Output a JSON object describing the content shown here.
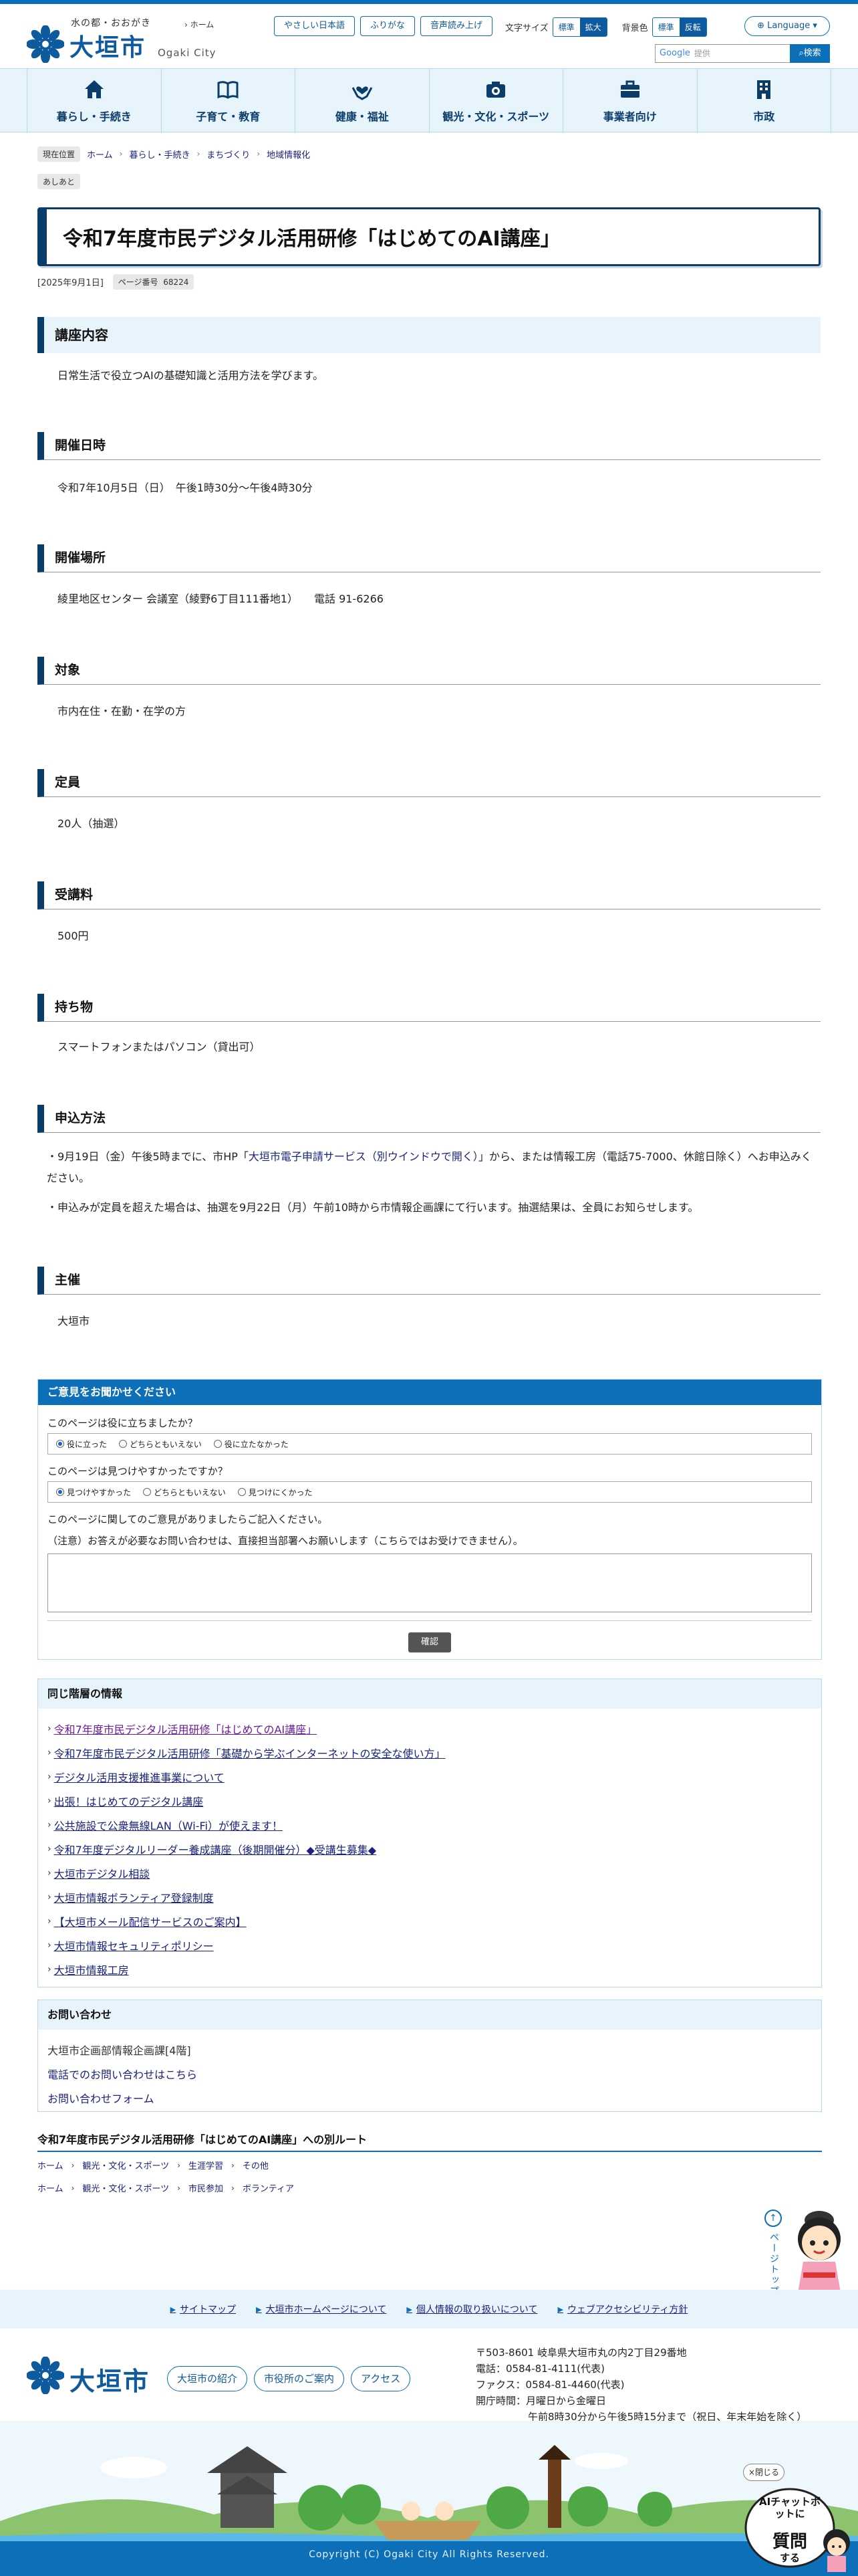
{
  "header": {
    "catchphrase": "水の都・おおがき",
    "logo_name": "大垣市",
    "logo_en": "Ogaki City",
    "home_link": "ホーム",
    "buttons": [
      "やさしい日本語",
      "ふりがな",
      "音声読み上げ"
    ],
    "font_size_label": "文字サイズ",
    "font_size_options": [
      "標準",
      "拡大"
    ],
    "bg_color_label": "背景色",
    "bg_color_options": [
      "標準",
      "反転"
    ],
    "language_label": "Language",
    "search_engine_label": "Google",
    "search_placeholder": "提供",
    "search_button": "検索"
  },
  "gnav": [
    {
      "label": "暮らし・手続き",
      "icon": "house-icon"
    },
    {
      "label": "子育て・教育",
      "icon": "book-icon"
    },
    {
      "label": "健康・福祉",
      "icon": "heart-hands-icon"
    },
    {
      "label": "観光・文化・スポーツ",
      "icon": "camera-icon"
    },
    {
      "label": "事業者向け",
      "icon": "briefcase-icon"
    },
    {
      "label": "市政",
      "icon": "building-icon"
    }
  ],
  "breadcrumb": {
    "label": "現在位置",
    "items": [
      "ホーム",
      "暮らし・手続き",
      "まちづくり",
      "地域情報化"
    ],
    "ashiato": "あしあと"
  },
  "page": {
    "title": "令和7年度市民デジタル活用研修「はじめてのAI講座」",
    "date": "[2025年9月1日]",
    "page_number_label": "ページ番号",
    "page_number": "68224"
  },
  "sections": {
    "content_heading": "講座内容",
    "content_text": "日常生活で役立つAIの基礎知識と活用方法を学びます。",
    "datetime_heading": "開催日時",
    "datetime_text": "令和7年10月5日（日）　午後1時30分～午後4時30分",
    "place_heading": "開催場所",
    "place_text": "綾里地区センター 会議室（綾野6丁目111番地1）　　電話 91-6266",
    "target_heading": "対象",
    "target_text": "市内在住・在勤・在学の方",
    "capacity_heading": "定員",
    "capacity_text": "20人（抽選）",
    "fee_heading": "受講料",
    "fee_text": "500円",
    "items_heading": "持ち物",
    "items_text": "スマートフォンまたはパソコン（貸出可）",
    "apply_heading": "申込方法",
    "apply_text1_a": "・9月19日（金）午後5時までに、市HP「",
    "apply_text1_link": "大垣市電子申請サービス（別ウインドウで開く）",
    "apply_text1_b": "」から、または情報工房（電話75-7000、休館日除く）へお申込みください。",
    "apply_text2": "・申込みが定員を超えた場合は、抽選を9月22日（月）午前10時から市情報企画課にて行います。抽選結果は、全員にお知らせします。",
    "host_heading": "主催",
    "host_text": "大垣市"
  },
  "feedback": {
    "heading": "ご意見をお聞かせください",
    "q1": "このページは役に立ちましたか？",
    "q1_options": [
      "役に立った",
      "どちらともいえない",
      "役に立たなかった"
    ],
    "q2": "このページは見つけやすかったですか？",
    "q2_options": [
      "見つけやすかった",
      "どちらともいえない",
      "見つけにくかった"
    ],
    "q3": "このページに関してのご意見がありましたらご記入ください。",
    "note": "（注意）お答えが必要なお問い合わせは、直接担当部署へお願いします（こちらではお受けできません）。",
    "submit": "確認"
  },
  "same_level": {
    "heading": "同じ階層の情報",
    "items": [
      "令和7年度市民デジタル活用研修「はじめてのAI講座」",
      "令和7年度市民デジタル活用研修「基礎から学ぶインターネットの安全な使い方」",
      "デジタル活用支援推進事業について",
      "出張！はじめてのデジタル講座",
      "公共施設で公衆無線LAN（Wi-Fi）が使えます！",
      "令和7年度デジタルリーダー養成講座（後期開催分）◆受講生募集◆",
      "大垣市デジタル相談",
      "大垣市情報ボランティア登録制度",
      "【大垣市メール配信サービスのご案内】",
      "大垣市情報セキュリティポリシー",
      "大垣市情報工房"
    ]
  },
  "contact": {
    "heading": "お問い合わせ",
    "dept": "大垣市企画部情報企画課[4階]",
    "phone_link": "電話でのお問い合わせはこちら",
    "form_link": "お問い合わせフォーム"
  },
  "routes": {
    "heading": "令和7年度市民デジタル活用研修「はじめてのAI講座」への別ルート",
    "route1": [
      "ホーム",
      "観光・文化・スポーツ",
      "生涯学習",
      "その他"
    ],
    "route2": [
      "ホーム",
      "観光・文化・スポーツ",
      "市民参加",
      "ボランティア"
    ]
  },
  "pagetop": "ページトップへ",
  "footer": {
    "links": [
      "サイトマップ",
      "大垣市ホームページについて",
      "個人情報の取り扱いについて",
      "ウェブアクセシビリティ方針"
    ],
    "logo_name": "大垣市",
    "buttons": [
      "大垣市の紹介",
      "市役所のご案内",
      "アクセス"
    ],
    "address": "〒503-8601 岐阜県大垣市丸の内2丁目29番地",
    "tel": "電話：0584-81-4111(代表)",
    "fax": "ファクス：0584-81-4460(代表)",
    "hours_label": "開庁時間：月曜日から金曜日",
    "hours": "午前8時30分から午後5時15分まで（祝日、年末年始を除く）",
    "copyright": "Copyright (C) Ogaki City All Rights Reserved."
  },
  "ai_chat": {
    "close": "×閉じる",
    "line1": "AIチャットボットに",
    "line2": "質問",
    "line3": "する"
  },
  "colors": {
    "primary": "#0d6fb8",
    "navy": "#0b3d6b",
    "light_blue": "#e8f4fb"
  }
}
